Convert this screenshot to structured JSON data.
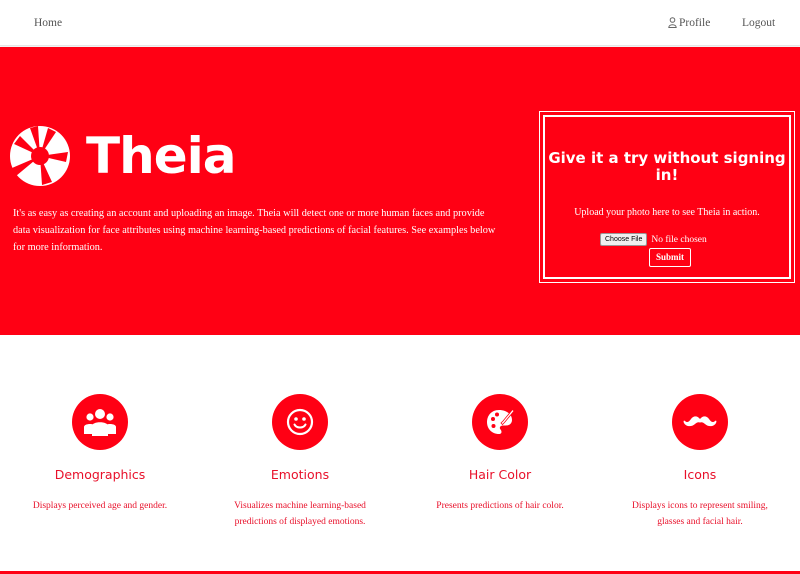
{
  "nav": {
    "home": "Home",
    "profile": "Profile",
    "logout": "Logout"
  },
  "hero": {
    "brand": "Theia",
    "description": "It's as easy as creating an account and uploading an image. Theia will detect one or more human faces and provide data visualization for face attributes using machine learning-based predictions of facial features. See examples below for more information.",
    "background_color": "#ff0014"
  },
  "try_box": {
    "title": "Give it a try without signing in!",
    "subtitle": "Upload your photo here to see Theia in action.",
    "file_button": "Choose File",
    "file_status": "No file chosen",
    "submit": "Submit"
  },
  "features": [
    {
      "icon": "users-icon",
      "title": "Demographics",
      "description": "Displays perceived age and gender."
    },
    {
      "icon": "smiley-icon",
      "title": "Emotions",
      "description": "Visualizes machine learning-based predictions of displayed emotions."
    },
    {
      "icon": "palette-icon",
      "title": "Hair Color",
      "description": "Presents predictions of hair color."
    },
    {
      "icon": "mustache-icon",
      "title": "Icons",
      "description": "Displays icons to represent smiling, glasses and facial hair."
    }
  ],
  "colors": {
    "accent": "#ff0014",
    "feature_text": "#e8102a"
  }
}
